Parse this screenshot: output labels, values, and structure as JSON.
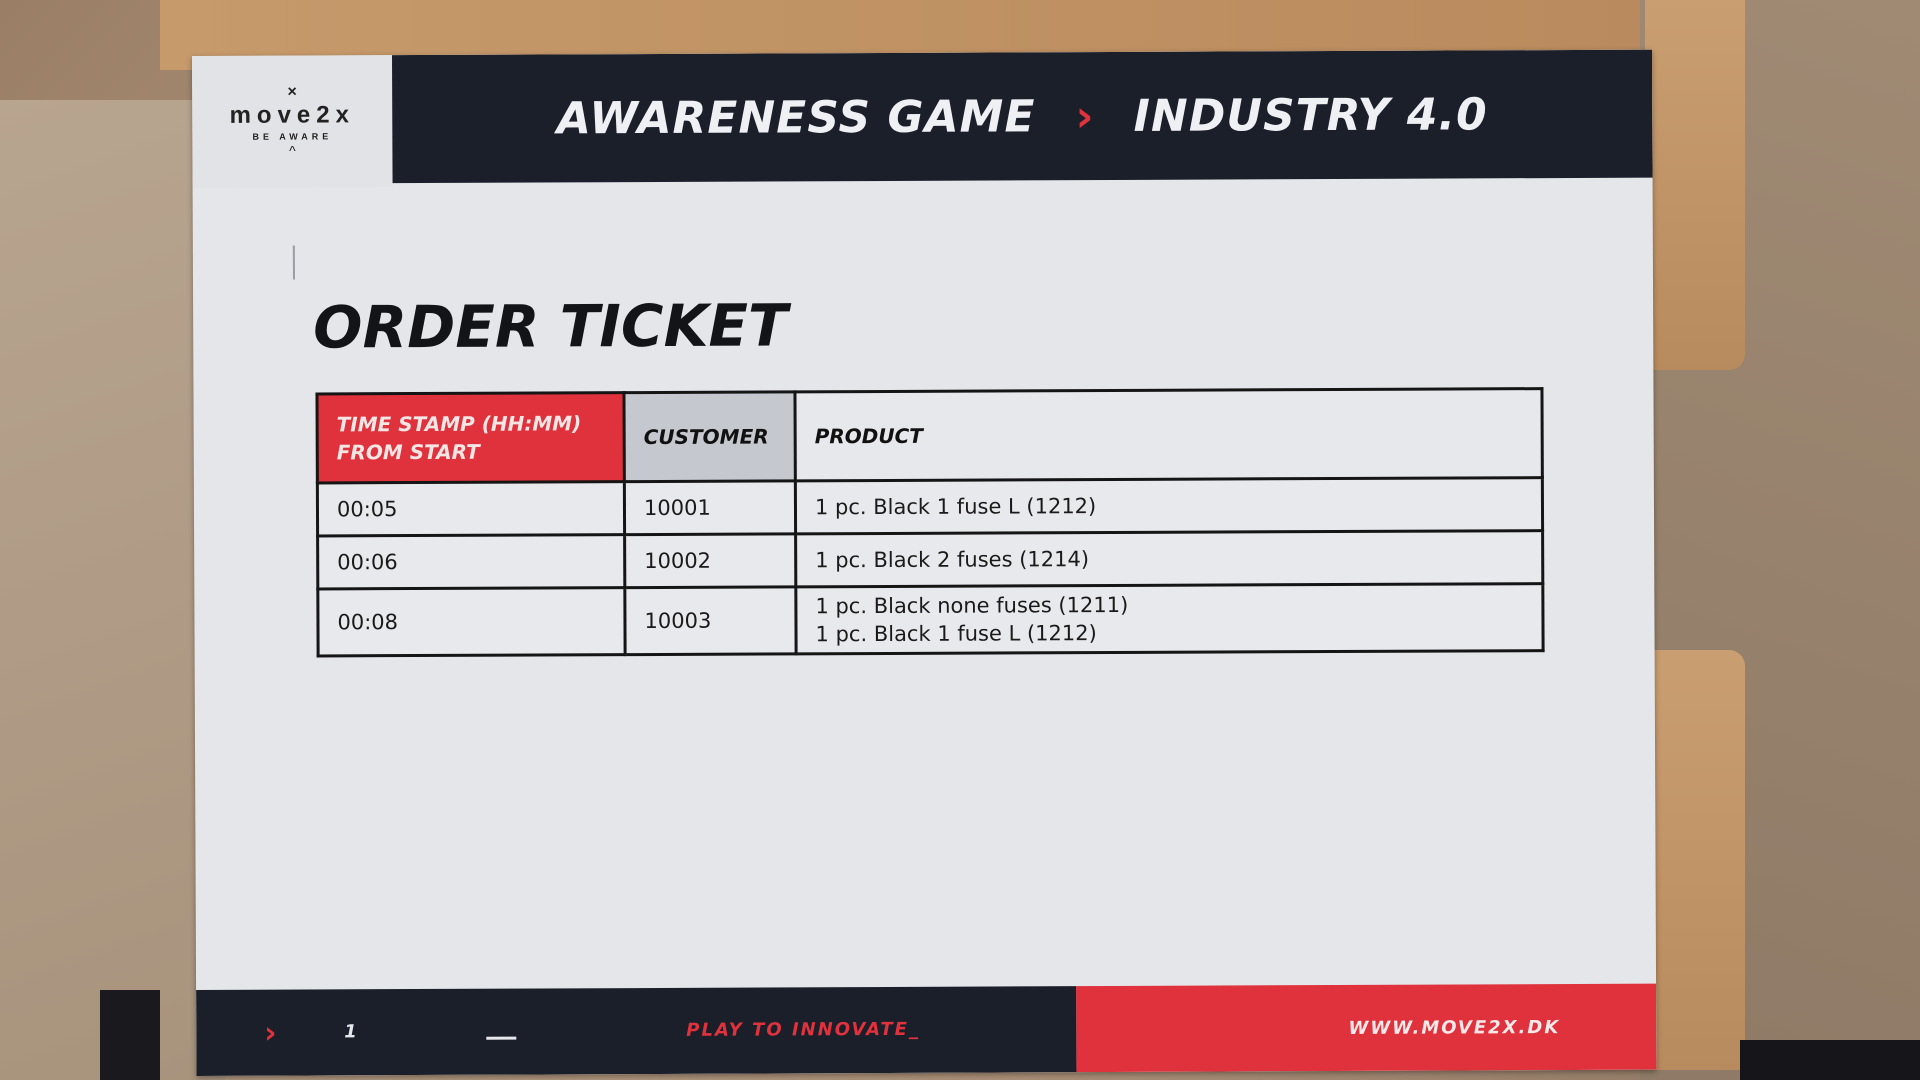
{
  "logo": {
    "mark": "×",
    "word": "move2x",
    "tagline": "BE AWARE",
    "caret": "^"
  },
  "header": {
    "title_left": "AWARENESS GAME",
    "separator": "›",
    "title_right": "INDUSTRY 4.0"
  },
  "ticket": {
    "title": "ORDER TICKET",
    "columns": [
      "TIME STAMP (HH:MM) FROM START",
      "CUSTOMER",
      "PRODUCT"
    ],
    "rows": [
      {
        "time": "00:05",
        "customer": "10001",
        "products": [
          "1 pc. Black 1 fuse L (1212)"
        ]
      },
      {
        "time": "00:06",
        "customer": "10002",
        "products": [
          "1 pc. Black 2 fuses  (1214)"
        ]
      },
      {
        "time": "00:08",
        "customer": "10003",
        "products": [
          "1 pc. Black none fuses (1211)",
          "1 pc. Black 1 fuse L (1212)"
        ]
      }
    ]
  },
  "footer": {
    "chevron": "›",
    "page": "1",
    "tagline": "PLAY TO INNOVATE_",
    "url": "WWW.MOVE2X.DK"
  },
  "colors": {
    "accent_red": "#e0323d",
    "dark_navy": "#1b1f2a",
    "paper": "#e4e6ea"
  }
}
